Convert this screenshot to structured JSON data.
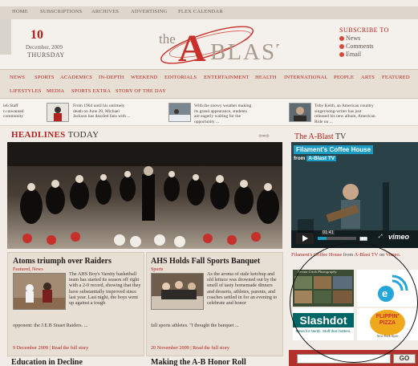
{
  "topnav": [
    "HOME",
    "SUBSCRIPTIONS",
    "ARCHIVES",
    "ADVERTISING",
    "FLEX CALENDAR"
  ],
  "date": {
    "day": "10",
    "month_year": "December, 2009",
    "weekday": "THURSDAY"
  },
  "logo": {
    "prefix": "the",
    "letter": "A",
    "word": "BLAST"
  },
  "subscribe": {
    "title": "SUBSCRIBE TO",
    "items": [
      "News",
      "Comments",
      "Email"
    ]
  },
  "sections_row1": [
    "NEWS",
    "SPORTS",
    "ACADEMICS",
    "IN-DEPTH",
    "WEEKEND",
    "EDITORIALS",
    "ENTERTAINMENT",
    "HEALTH",
    "INTERNATIONAL",
    "PEOPLE",
    "ARTS",
    "FEATURED"
  ],
  "sections_row2": [
    "LIFESTYLES",
    "MEDIA",
    "SPORTS EXTRA",
    "STORY OF THE DAY"
  ],
  "teasers": [
    {
      "text": "ieb Staff\nn unwanted\ncommunity"
    },
    {
      "text": "From 1964 until his untimely\ndeath on June 20, Michael\nJackson has dazzled fans with ..."
    },
    {
      "text": "With the snowy weather making\nits grand appearance, students\nare eagerly waiting for the\nopportunity ..."
    },
    {
      "text": "Toby Keith, an American country\nsinger/song-writer has just\nreleased his new album, American\nRide on ..."
    }
  ],
  "headlines": {
    "title": "HEADLINES",
    "today": "TODAY",
    "arrows": "⇦⇨"
  },
  "articles": [
    {
      "title": "Atoms triumph over Raiders",
      "category": "Featured, News",
      "body": "The AHS Boy's Varsity basketball team has started its season off right with a 2-0 record, showing that they have substantially improved since last year. Last night, the boys went up against a tough",
      "body_tail": "opponent: the J.E.B Stuart Raiders. ...",
      "footer": "9 December 2009 | Read the full story"
    },
    {
      "title": "AHS Holds Fall Sports Banquet",
      "category": "Sports",
      "body": "As the aroma of stale ketchup and old lettuce was drowned out by the smell of tasty homemade dinners and desserts, athletes, parents, and coaches settled in for an evening to celebrate and honor",
      "body_tail": "fall sports athletes. \"I thought the banquet ...",
      "footer": "20 November 2009 | Read the full story"
    }
  ],
  "bottom_titles": [
    "Education in Decline",
    "Making the A-B Honor Roll"
  ],
  "tv": {
    "title": "The A-Blast",
    "tv": "TV",
    "video_title": "Filament's Coffee House",
    "from_label": "from",
    "channel": "A-Blast TV",
    "time": "01:41",
    "player_logo": "vimeo",
    "caption_link": "Filament's Coffee House",
    "caption_from": "from",
    "caption_channel": "A-Blast TV",
    "caption_on": "on",
    "caption_site": "Vimeo."
  },
  "sponsors": {
    "photo_text": "Dream Creek Photography",
    "slashdot": "Slashdot",
    "slashdot_tagline": "News for Nerds. Stuff that matters.",
    "pizza1": "FLIPPIN'",
    "pizza2": "PIZZA",
    "pizza_tag": "New York Style"
  },
  "search": {
    "value": "",
    "button": "GO"
  },
  "colors": {
    "accent": "#b3211d",
    "background": "#f1ede6",
    "nav": "#e7dfd4"
  }
}
